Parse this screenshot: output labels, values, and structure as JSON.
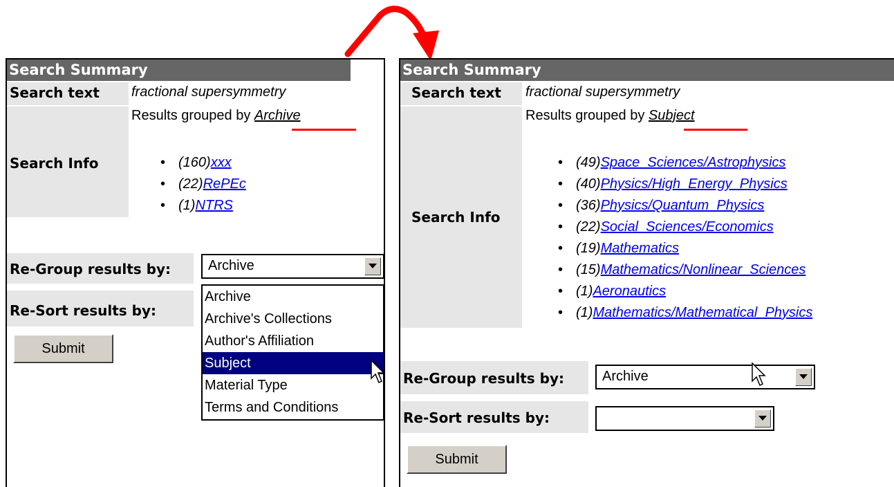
{
  "left": {
    "header": "Search Summary",
    "search_text_label": "Search text",
    "search_text_value": "fractional supersymmetry",
    "grouped_prefix": "Results grouped by",
    "grouped_value": "Archive",
    "search_info_label": "Search Info",
    "results": [
      {
        "count": "(160)",
        "name": "xxx"
      },
      {
        "count": "(22)",
        "name": "RePEc"
      },
      {
        "count": "(1)",
        "name": "NTRS"
      }
    ],
    "regroup_label": "Re-Group results by:",
    "regroup_value": "Archive",
    "resort_label": "Re-Sort results by:",
    "submit_label": "Submit",
    "dropdown_options": [
      "Archive",
      "Archive's Collections",
      "Author's Affiliation",
      "Subject",
      "Material Type",
      "Terms and Conditions"
    ],
    "dropdown_highlighted": "Subject"
  },
  "right": {
    "header": "Search Summary",
    "search_text_label": "Search text",
    "search_text_value": "fractional supersymmetry",
    "grouped_prefix": "Results grouped by",
    "grouped_value": "Subject",
    "search_info_label": "Search Info",
    "results": [
      {
        "count": "(49)",
        "name": "Space_Sciences/Astrophysics"
      },
      {
        "count": "(40)",
        "name": "Physics/High_Energy_Physics"
      },
      {
        "count": "(36)",
        "name": "Physics/Quantum_Physics"
      },
      {
        "count": "(22)",
        "name": "Social_Sciences/Economics"
      },
      {
        "count": "(19)",
        "name": "Mathematics"
      },
      {
        "count": "(15)",
        "name": "Mathematics/Nonlinear_Sciences"
      },
      {
        "count": "(1)",
        "name": "Aeronautics"
      },
      {
        "count": "(1)",
        "name": "Mathematics/Mathematical_Physics"
      }
    ],
    "regroup_label": "Re-Group results by:",
    "regroup_value": "Archive",
    "resort_label": "Re-Sort results by:",
    "resort_value": "",
    "submit_label": "Submit"
  },
  "colors": {
    "accent_red": "#ff0000",
    "header_bg": "#666666",
    "link": "#0000ee",
    "highlight": "#000080"
  },
  "icons": {
    "arrow": "curved-red-arrow-icon",
    "cursor": "mouse-pointer-icon",
    "dropdown": "chevron-down-icon"
  }
}
